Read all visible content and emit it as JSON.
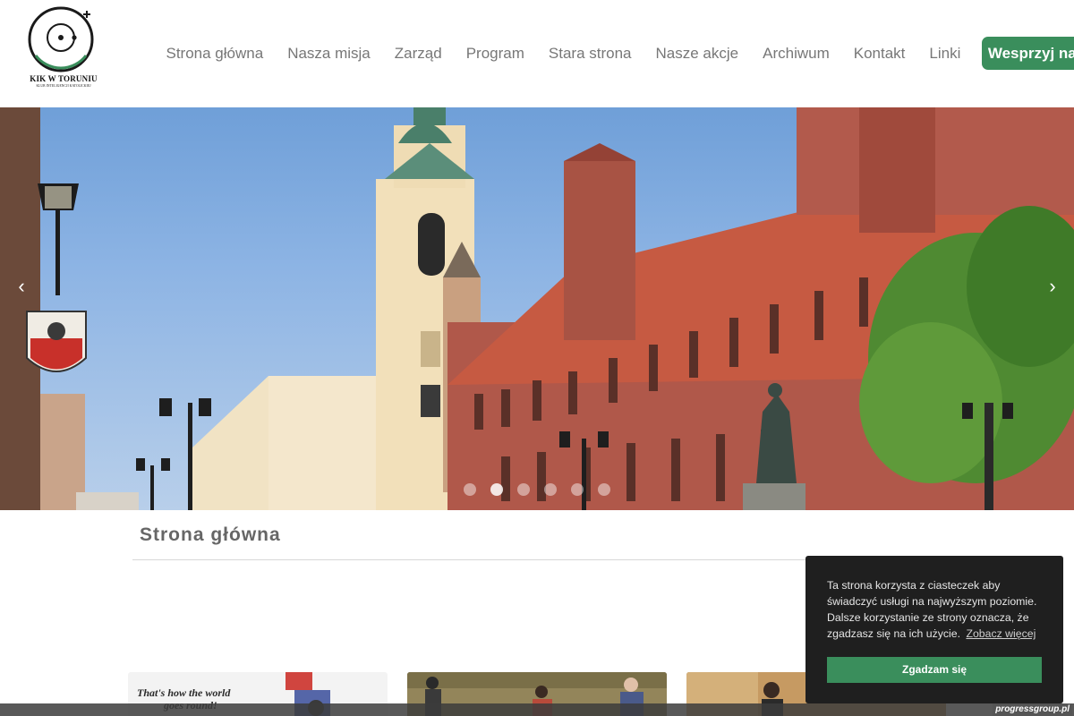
{
  "header": {
    "logo": {
      "title": "KIK W TORUNIU",
      "subtitle": "KLUB INTELIGENCJI KATOLICKIEJ",
      "icon": "kik-logo-icon"
    },
    "nav": {
      "items": [
        {
          "label": "Strona główna"
        },
        {
          "label": "Nasza misja"
        },
        {
          "label": "Zarząd"
        },
        {
          "label": "Program"
        },
        {
          "label": "Stara strona"
        },
        {
          "label": "Nasze akcje"
        },
        {
          "label": "Archiwum"
        },
        {
          "label": "Kontakt"
        },
        {
          "label": "Linki"
        }
      ],
      "cta_label": "Wesprzyj nas",
      "cta_color": "#3a8e5c"
    }
  },
  "slider": {
    "prev_icon": "chevron-left-icon",
    "next_icon": "chevron-right-icon",
    "prev_glyph": "‹",
    "next_glyph": "›",
    "slide_count": 6,
    "active_slide": 2
  },
  "main": {
    "page_title": "Strona główna",
    "cards": [
      {
        "line1": "That's how the world",
        "line2": "goes round!"
      }
    ]
  },
  "cookie": {
    "message": "Ta strona korzysta z ciasteczek aby świadczyć usługi na najwyższym poziomie. Dalsze korzystanie ze strony oznacza, że zgadzasz się na ich użycie.",
    "link_label": "Zobacz więcej",
    "accept_label": "Zgadzam się",
    "accept_color": "#3a8e5c"
  },
  "footer": {
    "credit": "progressgroup.pl"
  }
}
